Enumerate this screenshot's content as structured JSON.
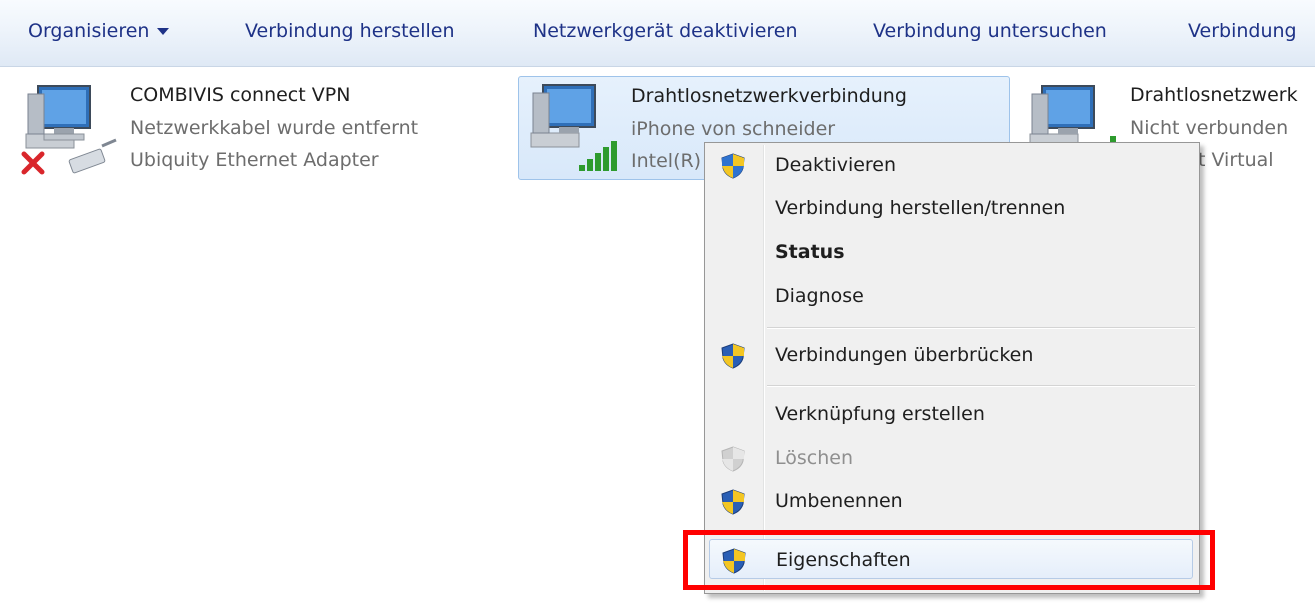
{
  "toolbar": {
    "organize": "Organisieren",
    "connect": "Verbindung herstellen",
    "disable_device": "Netzwerkgerät deaktivieren",
    "diagnose": "Verbindung untersuchen",
    "rename_partial": "Verbindung"
  },
  "connections": [
    {
      "name": "COMBIVIS connect VPN",
      "status": "Netzwerkkabel wurde entfernt",
      "adapter": "Ubiquity Ethernet Adapter",
      "icon": "network-disconnected-icon"
    },
    {
      "name": "Drahtlosnetzwerkverbindung",
      "status": "iPhone von schneider",
      "adapter": "Intel(R)",
      "icon": "wireless-signal-icon"
    },
    {
      "name": "Drahtlosnetzwerk",
      "status": "Nicht verbunden",
      "adapter": "oft Virtual",
      "icon": "wireless-network-icon"
    }
  ],
  "context_menu": {
    "items": [
      {
        "label": "Deaktivieren",
        "shield": true
      },
      {
        "label": "Verbindung herstellen/trennen",
        "shield": false
      },
      {
        "label": "Status",
        "shield": false,
        "bold": true
      },
      {
        "label": "Diagnose",
        "shield": false
      },
      {
        "label": "Verbindungen überbrücken",
        "shield": true
      },
      {
        "label": "Verknüpfung erstellen",
        "shield": false
      },
      {
        "label": "Löschen",
        "shield": true,
        "disabled": true
      },
      {
        "label": "Umbenennen",
        "shield": true
      },
      {
        "label": "Eigenschaften",
        "shield": true,
        "hovered": true
      }
    ]
  },
  "colors": {
    "toolbar_text": "#1e3287",
    "highlight": "#ff0000",
    "selection": "#d8e8fa"
  }
}
